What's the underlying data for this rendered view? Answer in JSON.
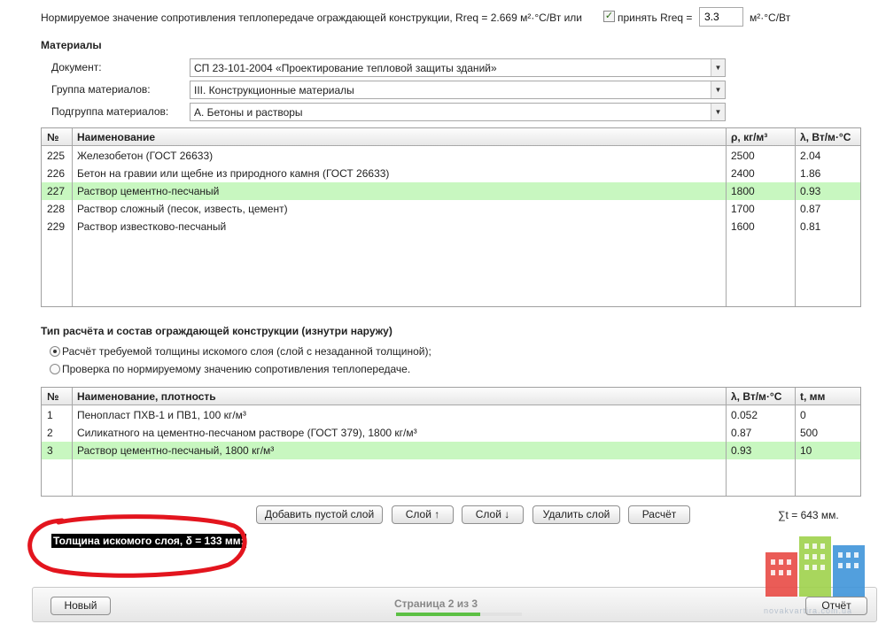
{
  "rreq": {
    "text": "Нормируемое значение сопротивления теплопередаче ограждающей конструкции, Rreq = 2.669 м²·°С/Вт или",
    "accept_label": "принять Rreq =",
    "accept_checked": true,
    "value": "3.3",
    "unit": "м²·°С/Вт"
  },
  "materials": {
    "title": "Материалы",
    "document_label": "Документ:",
    "document_value": "СП 23-101-2004 «Проектирование тепловой защиты зданий»",
    "group_label": "Группа материалов:",
    "group_value": "III. Конструкционные материалы",
    "subgroup_label": "Подгруппа материалов:",
    "subgroup_value": "А. Бетоны и растворы",
    "columns": {
      "num": "№",
      "name": "Наименование",
      "rho": "ρ, кг/м³",
      "lambda": "λ, Вт/м·°С"
    },
    "rows": [
      {
        "num": "225",
        "name": "Железобетон (ГОСТ 26633)",
        "rho": "2500",
        "lambda": "2.04"
      },
      {
        "num": "226",
        "name": "Бетон на гравии или щебне из природного камня (ГОСТ 26633)",
        "rho": "2400",
        "lambda": "1.86"
      },
      {
        "num": "227",
        "name": "Раствор цементно-песчаный",
        "rho": "1800",
        "lambda": "0.93"
      },
      {
        "num": "228",
        "name": "Раствор сложный (песок, известь, цемент)",
        "rho": "1700",
        "lambda": "0.87"
      },
      {
        "num": "229",
        "name": "Раствор известково-песчаный",
        "rho": "1600",
        "lambda": "0.81"
      }
    ]
  },
  "calc": {
    "title": "Тип расчёта и состав ограждающей конструкции (изнутри наружу)",
    "option1": "Расчёт требуемой толщины искомого слоя (слой с незаданной толщиной);",
    "option2": "Проверка по нормируемому значению сопротивления теплопередаче.",
    "columns": {
      "num": "№",
      "name": "Наименование, плотность",
      "lambda": "λ, Вт/м·°С",
      "t": "t, мм"
    },
    "rows": [
      {
        "num": "1",
        "name": "Пенопласт ПХВ-1 и ПВ1, 100 кг/м³",
        "lambda": "0.052",
        "t": "0"
      },
      {
        "num": "2",
        "name": "Силикатного на цементно-песчаном растворе (ГОСТ 379), 1800 кг/м³",
        "lambda": "0.87",
        "t": "500"
      },
      {
        "num": "3",
        "name": "Раствор цементно-песчаный, 1800 кг/м³",
        "lambda": "0.93",
        "t": "10"
      }
    ]
  },
  "buttons": {
    "add_empty": "Добавить пустой слой",
    "up": "Слой ↑",
    "down": "Слой ↓",
    "delete": "Удалить слой",
    "calc": "Расчёт"
  },
  "sum_text": "∑t = 643 мм.",
  "result_text": "Толщина искомого слоя, δ = 133 мм;",
  "footer": {
    "new_button": "Новый",
    "report_button": "Отчёт",
    "progress_label": "Страница 2 из 3",
    "progress_fraction": 0.667
  },
  "watermark": "novakvartira.com.ua",
  "colors": {
    "selected_row": "#c8f7c0",
    "annotation_red": "#e3151e",
    "progress_green": "#5cc044"
  }
}
